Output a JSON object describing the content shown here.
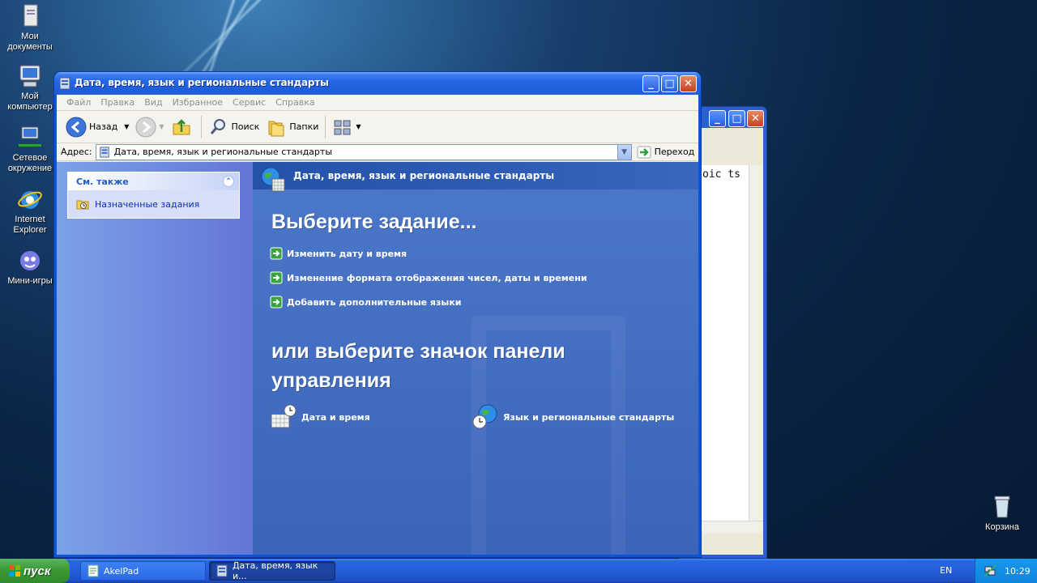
{
  "desktop": {
    "icons": [
      {
        "name": "my-documents-icon",
        "label": "Мои документы"
      },
      {
        "name": "my-computer-icon",
        "label": "Мой компьютер"
      },
      {
        "name": "network-places-icon",
        "label": "Сетевое окружение"
      },
      {
        "name": "internet-explorer-icon",
        "label": "Internet Explorer"
      },
      {
        "name": "mini-games-icon",
        "label": "Мини-игры"
      },
      {
        "name": "recycle-bin-icon",
        "label": "Корзина"
      }
    ]
  },
  "background_window": {
    "editor_text": "oic ts"
  },
  "window": {
    "title": "Дата, время, язык и региональные стандарты",
    "menu": [
      "Файл",
      "Правка",
      "Вид",
      "Избранное",
      "Сервис",
      "Справка"
    ],
    "toolbar": {
      "back_label": "Назад",
      "search_label": "Поиск",
      "folders_label": "Папки"
    },
    "address": {
      "label": "Адрес:",
      "value": "Дата, время, язык и региональные стандарты",
      "go_label": "Переход"
    },
    "see_also": {
      "title": "См. также",
      "items": [
        "Назначенные задания"
      ]
    },
    "content": {
      "header": "Дата, время, язык и региональные стандарты",
      "pick_task": "Выберите задание...",
      "tasks": [
        "Изменить дату и время",
        "Изменение формата отображения чисел, даты и времени",
        "Добавить дополнительные языки"
      ],
      "or_pick_icon": "или выберите значок панели управления",
      "control_panel_icons": [
        "Дата и время",
        "Язык и региональные стандарты"
      ]
    }
  },
  "taskbar": {
    "start_label": "пуск",
    "tasks": [
      {
        "label": "AkelPad",
        "active": false
      },
      {
        "label": "Дата, время, язык и...",
        "active": true
      }
    ],
    "language": "EN",
    "clock": "10:29"
  },
  "colors": {
    "titlebar_blue": "#245fd3",
    "start_green": "#3a9a36",
    "content_blue": "#4c78c9",
    "link_blue": "#0c2cba"
  }
}
